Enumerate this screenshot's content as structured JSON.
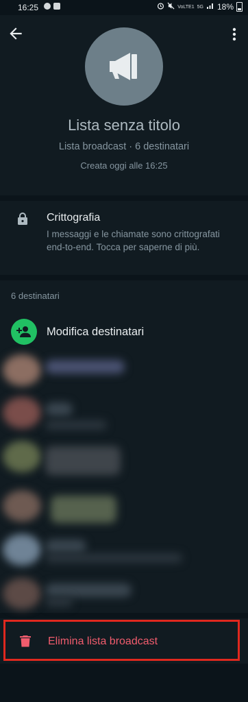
{
  "status_bar": {
    "time": "16:25",
    "network_label": "VoLTE1",
    "network_type": "5G",
    "battery": "18%"
  },
  "header": {
    "title": "Lista senza titolo",
    "subtitle": "Lista broadcast · 6 destinatari",
    "created": "Creata oggi alle 16:25"
  },
  "encryption": {
    "title": "Crittografia",
    "description": "I messaggi e le chiamate sono crittografati end-to-end. Tocca per saperne di più."
  },
  "recipients": {
    "count_label": "6 destinatari",
    "edit_label": "Modifica destinatari"
  },
  "delete": {
    "label": "Elimina lista broadcast"
  },
  "colors": {
    "background": "#0b141a",
    "panel": "#111b21",
    "accent_green": "#21c063",
    "danger_text": "#f15c6d",
    "highlight_border": "#e0281e"
  }
}
